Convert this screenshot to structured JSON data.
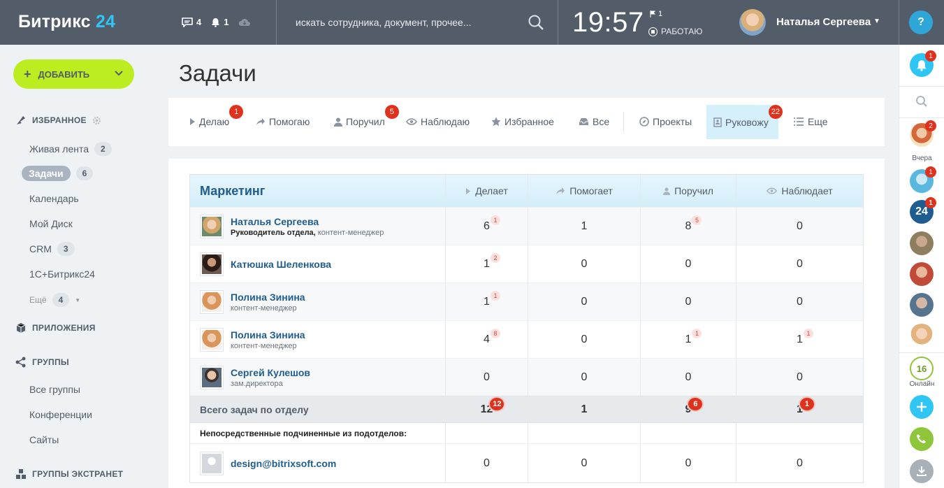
{
  "header": {
    "logo_text": "Битрикс",
    "logo_num": "24",
    "messages_count": "4",
    "notifications_count": "1",
    "search_placeholder": "искать сотрудника, документ, прочее...",
    "clock": "19:57",
    "flag_count": "1",
    "work_status": "РАБОТАЮ",
    "user_name": "Наталья Сергеева",
    "help_label": "?"
  },
  "sidebar": {
    "add_button": "ДОБАВИТЬ",
    "favorites_title": "ИЗБРАННОЕ",
    "items": [
      {
        "label": "Живая лента",
        "count": "2"
      },
      {
        "label": "Задачи",
        "count": "6"
      },
      {
        "label": "Календарь",
        "count": ""
      },
      {
        "label": "Мой Диск",
        "count": ""
      },
      {
        "label": "CRM",
        "count": "3"
      },
      {
        "label": "1С+Битрикс24",
        "count": ""
      }
    ],
    "more_label": "Ещё",
    "more_count": "4",
    "apps_title": "ПРИЛОЖЕНИЯ",
    "groups_title": "ГРУППЫ",
    "group_items": [
      "Все группы",
      "Конференции",
      "Сайты"
    ],
    "extranet_title": "ГРУППЫ ЭКСТРАНЕТ"
  },
  "page": {
    "title": "Задачи"
  },
  "tabs": [
    {
      "label": "Делаю",
      "badge": "1"
    },
    {
      "label": "Помогаю",
      "badge": ""
    },
    {
      "label": "Поручил",
      "badge": "5"
    },
    {
      "label": "Наблюдаю",
      "badge": ""
    },
    {
      "label": "Избранное",
      "badge": ""
    },
    {
      "label": "Все",
      "badge": ""
    },
    {
      "label": "Проекты",
      "badge": ""
    },
    {
      "label": "Руковожу",
      "badge": "22"
    },
    {
      "label": "Еще",
      "badge": ""
    }
  ],
  "table": {
    "department": "Маркетинг",
    "columns": [
      "Делает",
      "Помогает",
      "Поручил",
      "Наблюдает"
    ],
    "rows": [
      {
        "name": "Наталья Сергеева",
        "pos_bold": "Руководитель отдела,",
        "pos": "контент-менеджер",
        "does": "6",
        "does_b": "1",
        "helps": "1",
        "helps_b": "",
        "assigned": "8",
        "assigned_b": "5",
        "watches": "0",
        "watches_b": ""
      },
      {
        "name": "Катюшка Шеленкова",
        "pos_bold": "",
        "pos": "",
        "does": "1",
        "does_b": "2",
        "helps": "0",
        "helps_b": "",
        "assigned": "0",
        "assigned_b": "",
        "watches": "0",
        "watches_b": ""
      },
      {
        "name": "Полина Зинина",
        "pos_bold": "",
        "pos": "контент-менеджер",
        "does": "1",
        "does_b": "1",
        "helps": "0",
        "helps_b": "",
        "assigned": "0",
        "assigned_b": "",
        "watches": "0",
        "watches_b": ""
      },
      {
        "name": "Полина Зинина",
        "pos_bold": "",
        "pos": "контент-менеджер",
        "does": "4",
        "does_b": "8",
        "helps": "0",
        "helps_b": "",
        "assigned": "1",
        "assigned_b": "1",
        "watches": "1",
        "watches_b": "1"
      },
      {
        "name": "Сергей Кулешов",
        "pos_bold": "",
        "pos": "зам.директора",
        "does": "0",
        "does_b": "",
        "helps": "0",
        "helps_b": "",
        "assigned": "0",
        "assigned_b": "",
        "watches": "0",
        "watches_b": ""
      }
    ],
    "total": {
      "label": "Всего задач по отделу",
      "does": "12",
      "does_b": "12",
      "helps": "1",
      "helps_b": "",
      "assigned": "9",
      "assigned_b": "6",
      "watches": "1",
      "watches_b": "1"
    },
    "sub_label": "Непосредственные подчиненные из подотделов:",
    "sub_rows": [
      {
        "name": "design@bitrixsoft.com",
        "does": "0",
        "helps": "0",
        "assigned": "0",
        "watches": "0"
      }
    ]
  },
  "rightbar": {
    "notif_badge": "1",
    "chat1_badge": "2",
    "yesterday_label": "Вчера",
    "chat2_badge": "1",
    "chat3_badge": "1",
    "chat3_text": "24",
    "online_count": "16",
    "online_label": "Онлайн"
  }
}
